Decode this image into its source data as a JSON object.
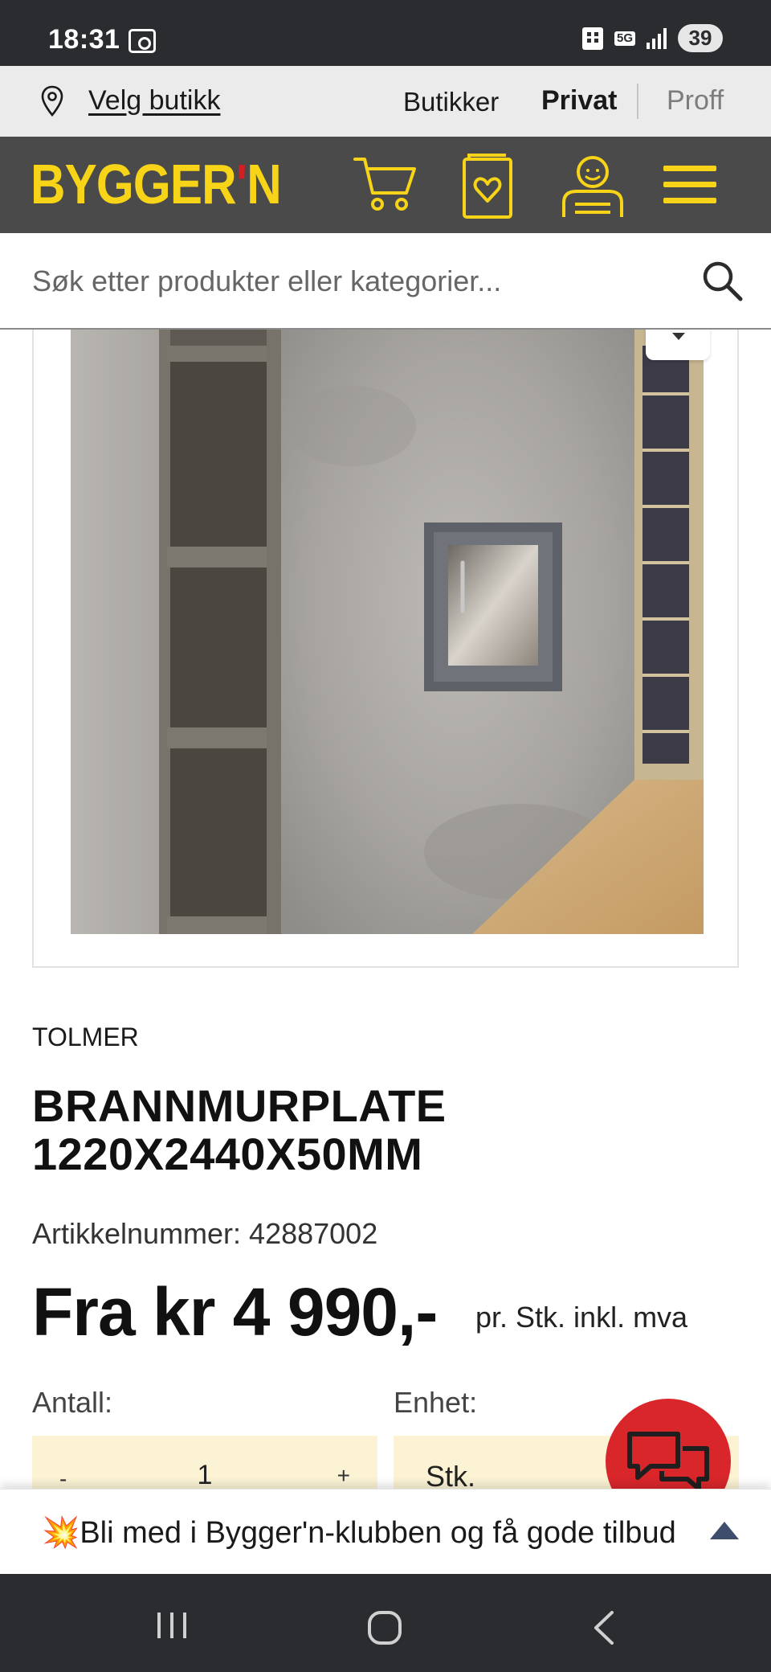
{
  "status_bar": {
    "time": "18:31",
    "network": "5G",
    "battery": "39"
  },
  "top_links": {
    "store_link": "Velg butikk",
    "butikker": "Butikker",
    "privat": "Privat",
    "proff": "Proff"
  },
  "header": {
    "logo_main": "BYGGER",
    "logo_apos": "'",
    "logo_end": "N",
    "icons": [
      "cart-icon",
      "wishlist-icon",
      "user-icon",
      "menu-icon"
    ]
  },
  "search": {
    "placeholder": "Søk etter produkter eller kategorier..."
  },
  "product": {
    "image_icon": "fireplace-wall-photo",
    "brand": "TOLMER",
    "title": "BRANNMURPLATE 1220X2440X50MM",
    "sku": "Artikkelnummer: 42887002",
    "price": "Fra kr 4 990,-",
    "price_suffix": "pr. Stk. inkl. mva",
    "qty_label": "Antall:",
    "qty_minus": "-",
    "qty_value": "1",
    "qty_plus": "+",
    "unit_label": "Enhet:",
    "unit_value": "Stk."
  },
  "banner": {
    "text": "💥Bli med i Bygger'n-klubben og få gode tilbud"
  },
  "colors": {
    "brand_yellow": "#f7d417",
    "header_gray": "#4a4a4a",
    "chat_red": "#d8262b",
    "input_bg": "#fcf3d4"
  }
}
